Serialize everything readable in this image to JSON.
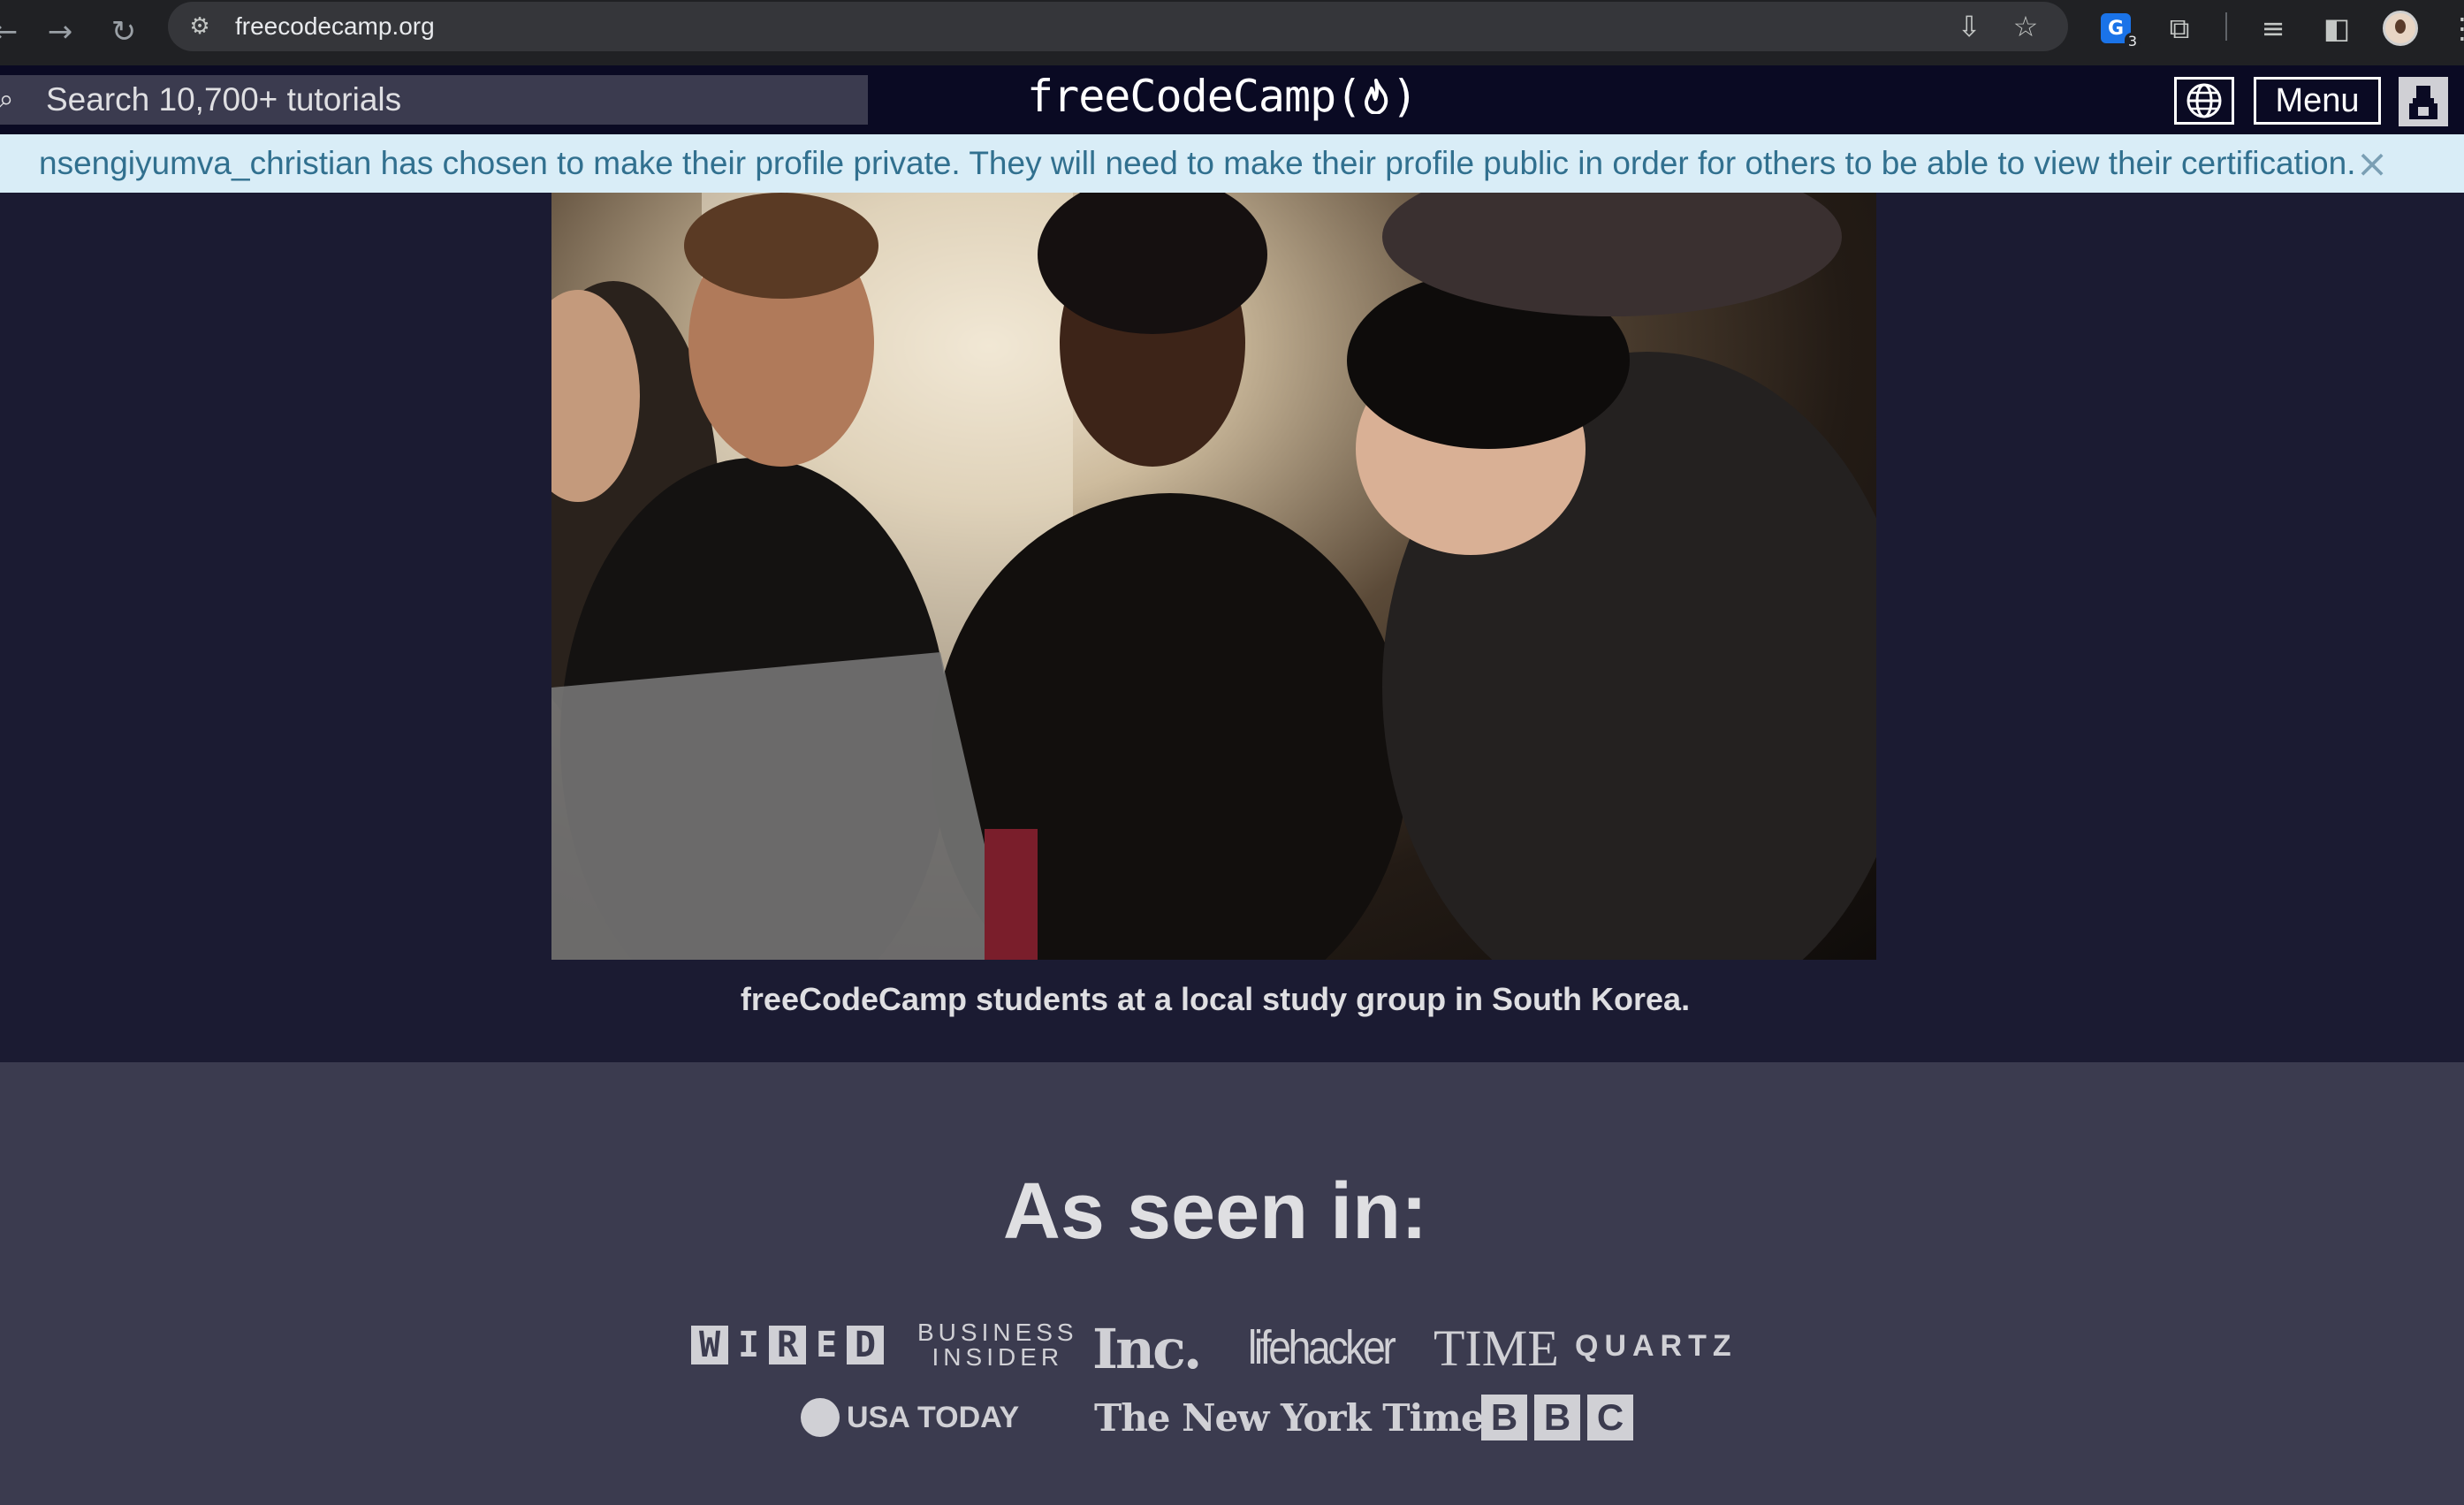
{
  "browser": {
    "url": "freecodecamp.org",
    "extension_badge": "3"
  },
  "navbar": {
    "search_placeholder": "Search 10,700+ tutorials",
    "logo_text": "freeCodeCamp",
    "logo_open": "(",
    "logo_close": ")",
    "menu_label": "Menu"
  },
  "alert": {
    "message": "nsengiyumva_christian has chosen to make their profile private. They will need to make their profile public in order for others to be able to view their certification.",
    "close_symbol": "×"
  },
  "photo": {
    "caption": "freeCodeCamp students at a local study group in South Korea."
  },
  "press": {
    "title": "As seen in:",
    "wired_letters": [
      "W",
      "I",
      "R",
      "E",
      "D"
    ],
    "business_insider_line1": "BUSINESS",
    "business_insider_line2": "INSIDER",
    "inc": "Inc.",
    "lifehacker": "lifehacker",
    "time": "TIME",
    "quartz": "QUARTZ",
    "usatoday": "USA TODAY",
    "nyt": "The New York Times",
    "bbc_letters": [
      "B",
      "B",
      "C"
    ]
  },
  "colors": {
    "page_bg": "#0a0a23",
    "section_dark": "#1b1b32",
    "section_gray": "#3b3b4f",
    "alert_bg": "#d9edf7",
    "alert_text": "#31708f"
  }
}
